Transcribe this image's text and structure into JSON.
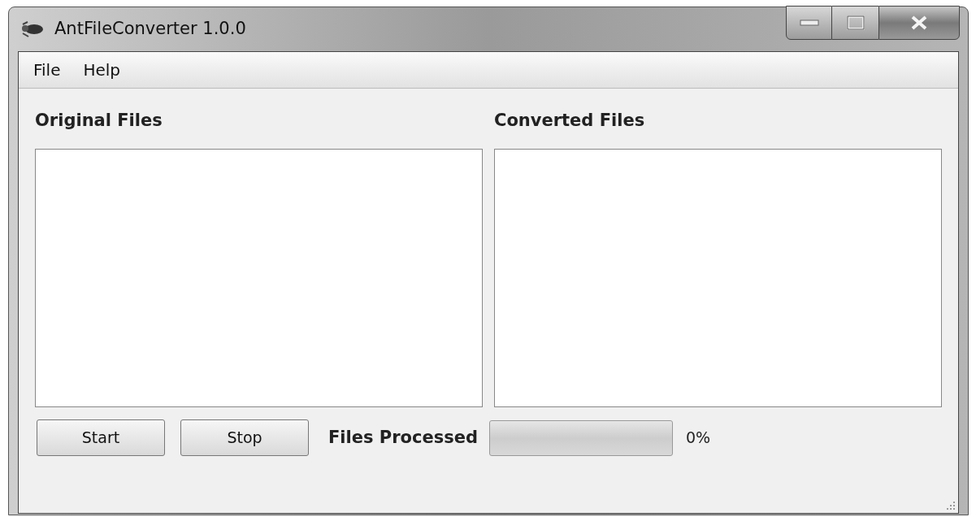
{
  "window": {
    "title": "AntFileConverter 1.0.0"
  },
  "menu": [
    "File",
    "Help"
  ],
  "panels": [
    {
      "heading": "Original Files"
    },
    {
      "heading": "Converted Files"
    }
  ],
  "buttons": [
    "Start",
    "Stop"
  ],
  "progress": {
    "label": "Files Processed",
    "level": 0,
    "reading": "0%"
  }
}
